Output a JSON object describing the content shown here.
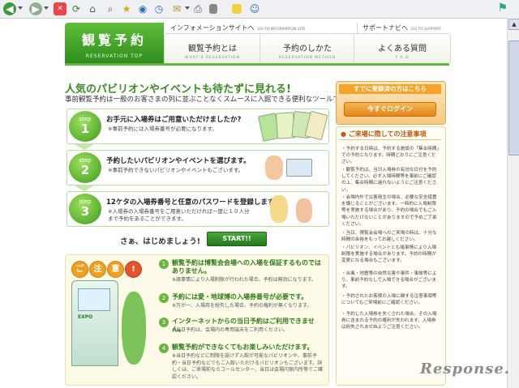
{
  "browser": {
    "toolbar_icons": [
      "back-icon",
      "forward-icon",
      "stop-icon",
      "refresh-icon",
      "home-icon",
      "search-icon",
      "favorites-icon",
      "media-icon",
      "history-icon",
      "mail-icon",
      "print-icon",
      "edit-icon",
      "discuss-icon",
      "messenger-icon"
    ]
  },
  "header": {
    "logo_title": "観覧予約",
    "logo_sub": "RESERVATION TOP",
    "sub_links": [
      {
        "label": "インフォメーションサイトへ",
        "en": "GO TO INFORMATION SITE"
      },
      {
        "label": "サポートナビへ",
        "en": "GO TO SUPPORT-NAVI SITE"
      }
    ],
    "tabs": [
      {
        "label": "観覧予約とは",
        "en": "WHAT'S RESERVATION"
      },
      {
        "label": "予約のしかた",
        "en": "RESERVATION METHOD"
      },
      {
        "label": "よくある質問",
        "en": "F A Q"
      }
    ]
  },
  "main": {
    "heading": "人気のパビリオンやイベントも待たずに見れる!",
    "subheading": "事前観覧予約は一般のお客さまの列に並ぶことなくスムースに入館できる便利なツールです。",
    "steps": [
      {
        "step": "step",
        "num": "1",
        "title": "お手元に入場券はご用意いただけましたか?",
        "note": "※事前予約には入場券番号が必要になります。"
      },
      {
        "step": "step",
        "num": "2",
        "title": "予約したいパビリオンやイベントを選びます。",
        "note": "※事前予約できないパビリオンやイベントもございます。"
      },
      {
        "step": "step",
        "num": "3",
        "title": "12ケタの入場券番号と任意のパスワードを登録します。",
        "note": "※入場券の入場券番号をご用意いただければ一度に１０人分まで予約をあることができます。"
      }
    ],
    "start_text": "さぁ、はじめましょう!",
    "start_button": "START!!",
    "attention": {
      "chars": [
        "ご",
        "注",
        "意",
        "!"
      ],
      "logo": "EXPO",
      "items": [
        {
          "num": "1",
          "title": "観覧予約は博覧会会場への入場を保証するものではありません。",
          "note": "※諸事情により入場制限が行われた場合、予約は無効になります。"
        },
        {
          "num": "2",
          "title": "予約には愛・地球博の入場券番号が必要です。",
          "note": "※万が一、入場券を紛失した場合、予約の権利が無くなります。"
        },
        {
          "num": "3",
          "title": "インターネットからの当日予約はご利用できません。",
          "note": "※当日予約は、会場内の専用端末をご利用ください。"
        },
        {
          "num": "4",
          "title": "観覧予約ができなくてもお楽しみいただけます。",
          "note": "※当日予約などに制限を設けず入館が可能なパビリオンや、事前予約・当日予約などでもご入館いただけるパビリオンもございます。詳しくは、ご来場前ならコールセンター、当日は会場内案内所等でご確認ください。"
        }
      ]
    }
  },
  "sidebar": {
    "registered_head": "すでに登録済の方はこちら",
    "login_button": "今すぐログイン",
    "notes_head": "ご来場に際しての注意事項",
    "notes": [
      "予約する日時は、予約する施設の「集合時間」での予約となります。時間どおりにご注意ください。",
      "観覧予約は、当日入場券の有効な日付を予約してください。必ず入場時間等を事前にご確認の上、集合時間に遅れないようにご注意ください。",
      "会場内外で災害発生の場合、必要な安全措置を講じることがございます。一時的に入場制限等を実施する場合があり、予約の場合でもご入場いただけないことがありますので予めご了承ください。",
      "当日、博覧会会場へのご来場の時は、十分な時間の余裕をもってお越しください。",
      "パビリオン、イベントとも諸事情により入場制限を実施する場合があります。予約の時間が変更になる場合もございます。",
      "台風・地震等の自然災害や事件・事故等により、事前予約なしで入場できる場合がございます。",
      "予約されたお客様の入場に関する注意事項等についてもご来場前にご確認ください。",
      "予約した入場券を失くされた場合、その入場券に含まれる予約の権利が失われます。入場券は紛失されませぬようご注意ください。"
    ]
  },
  "watermark": "Response."
}
